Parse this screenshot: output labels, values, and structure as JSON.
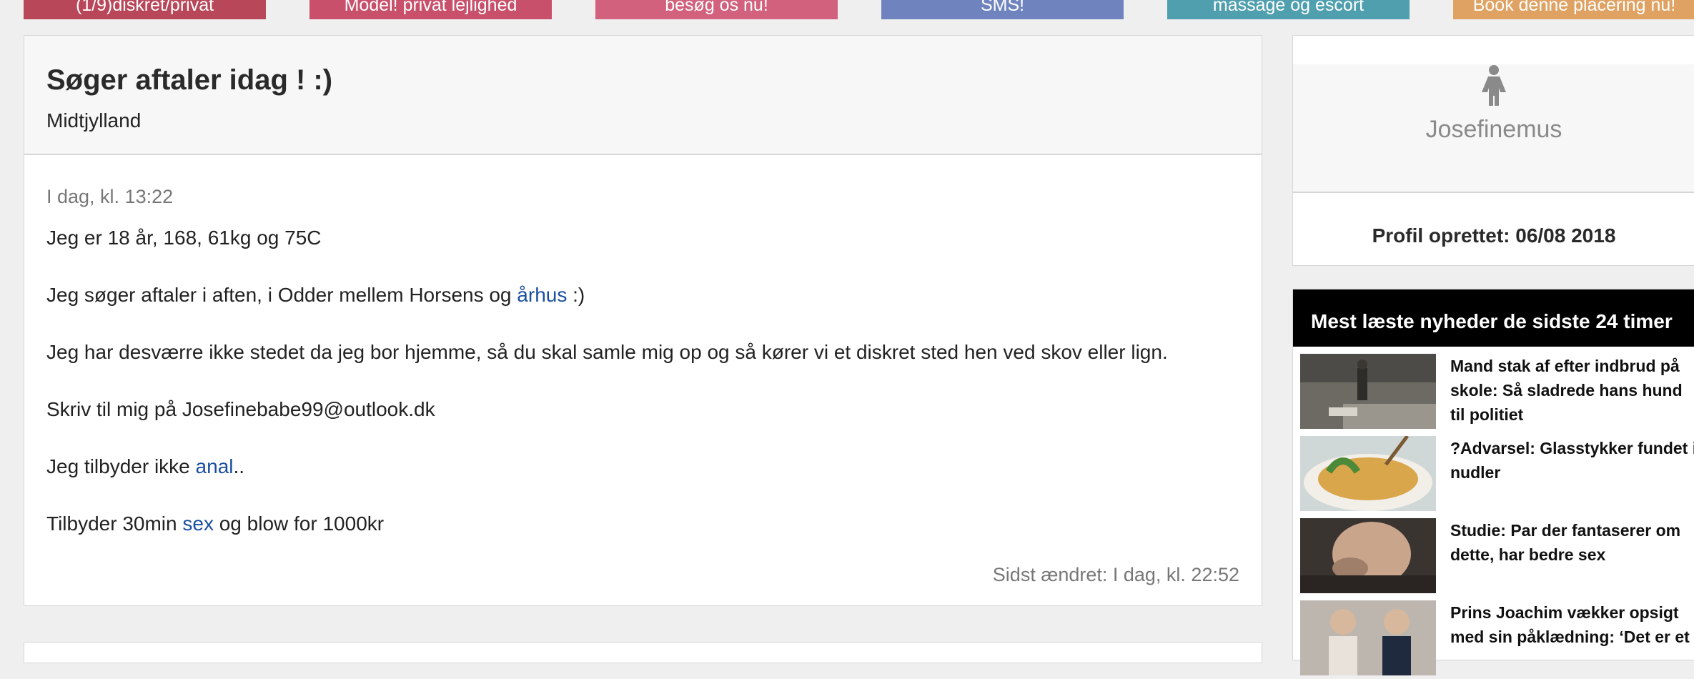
{
  "banners": [
    {
      "label": "(1/9)diskret/privat",
      "color": "#b8475a"
    },
    {
      "label": "Model! privat lejlighed",
      "color": "#c8506a"
    },
    {
      "label": "besøg os nu!",
      "color": "#d1617c"
    },
    {
      "label": "SMS!",
      "color": "#6f84bf"
    },
    {
      "label": "massage og escort",
      "color": "#4f9fae"
    },
    {
      "label": "Book denne placering nu!",
      "color": "#e0a262"
    }
  ],
  "ad": {
    "title": "Søger aftaler idag ! :)",
    "region": "Midtjylland",
    "date": "I dag, kl. 13:22",
    "line1": "Jeg er 18 år, 168, 61kg og 75C",
    "line2_pre": "Jeg søger aftaler i aften, i Odder mellem Horsens og ",
    "line2_link": "århus",
    "line2_post": " :)",
    "line3": "Jeg har desværre ikke stedet da jeg bor hjemme, så du skal samle mig op og så kører vi et diskret sted hen ved skov eller lign.",
    "line4": "Skriv til mig på Josefinebabe99@outlook.dk",
    "line5_pre": "Jeg tilbyder ikke ",
    "line5_link": "anal",
    "line5_post": "..",
    "line6_pre": "Tilbyder 30min ",
    "line6_link": "sex",
    "line6_post": " og blow for 1000kr",
    "modified": "Sidst ændret: I dag, kl. 22:52"
  },
  "profile": {
    "icon": "female-person-icon",
    "name": "Josefinemus",
    "created": "Profil oprettet: 06/08 2018"
  },
  "news": {
    "heading": "Mest læste nyheder de sidste 24 timer",
    "items": [
      {
        "title": "Mand stak af efter indbrud på skole: Så sladrede hans hund til politiet"
      },
      {
        "title": "?Advarsel: Glasstykker fundet i nudler"
      },
      {
        "title": "Studie: Par der fantaserer om dette, har bedre sex"
      },
      {
        "title": "Prins Joachim vækker opsigt med sin påklædning: ‘Det er et"
      }
    ]
  }
}
